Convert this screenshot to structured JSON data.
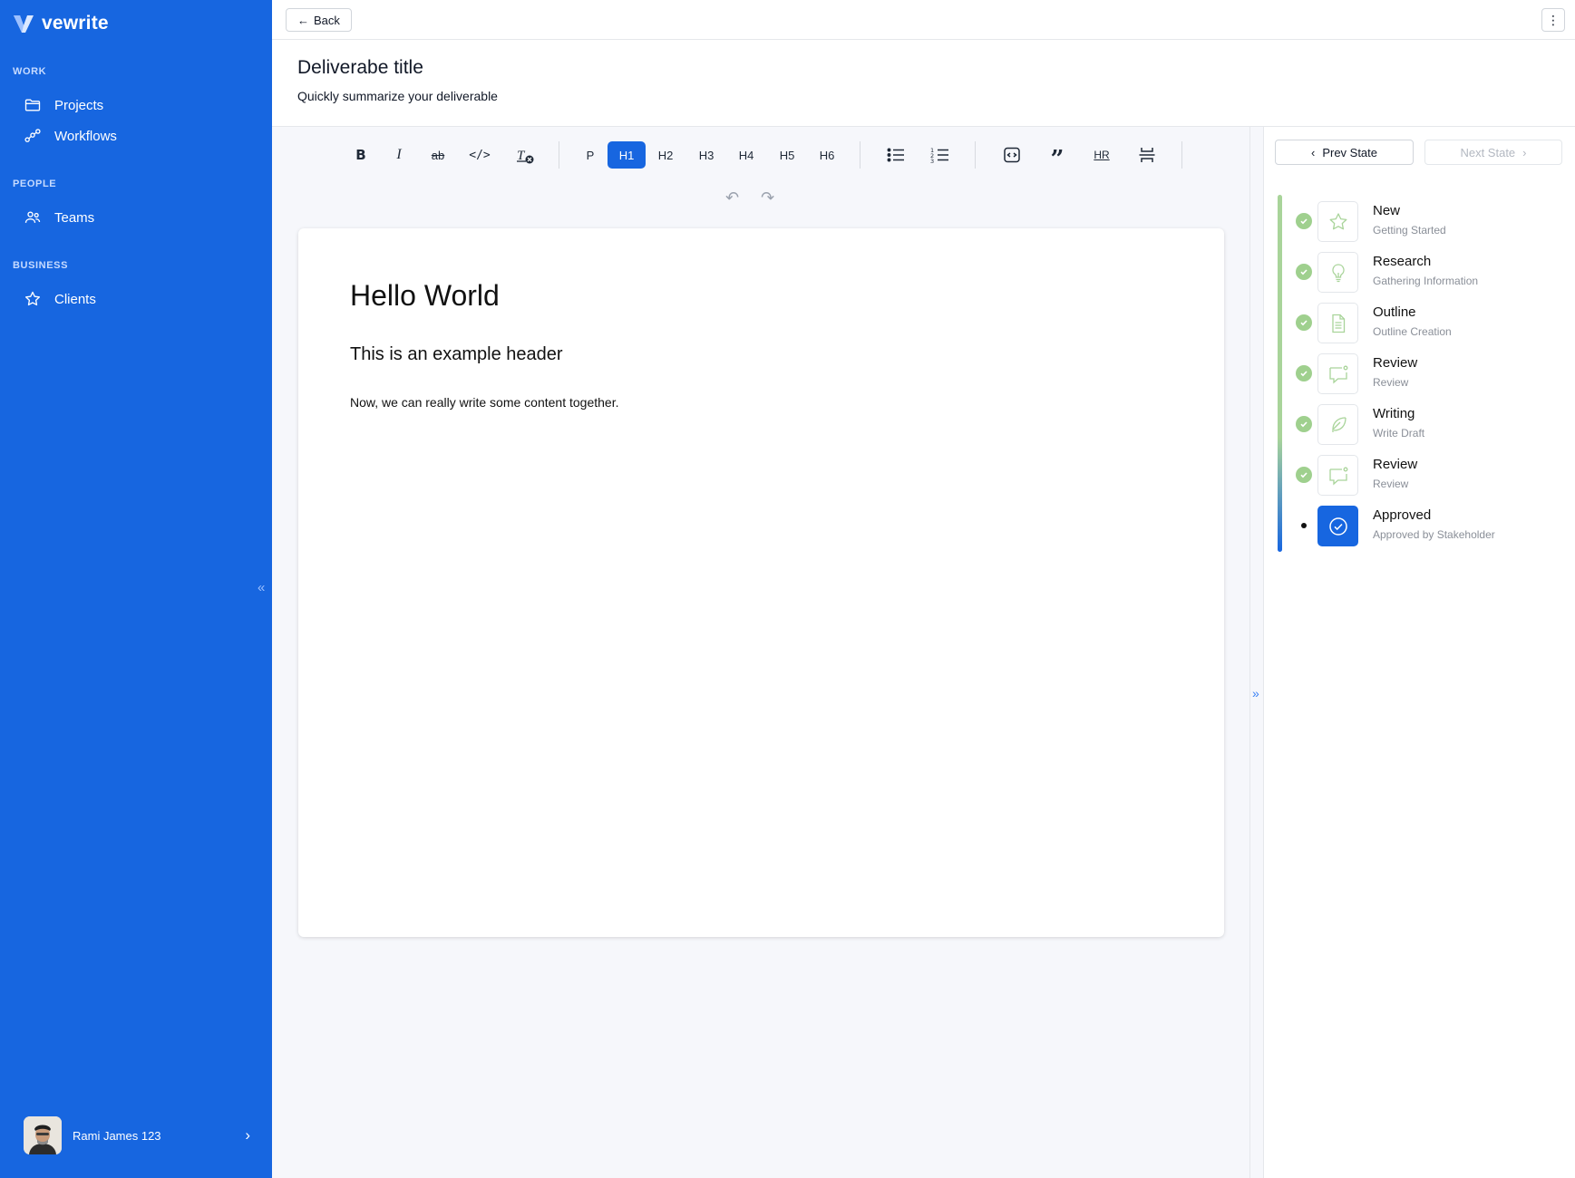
{
  "brand": {
    "name": "vewrite",
    "accent": "#1766e0"
  },
  "sidebar": {
    "sections": [
      {
        "label": "WORK",
        "items": [
          {
            "label": "Projects",
            "icon": "folder-icon"
          },
          {
            "label": "Workflows",
            "icon": "workflow-icon"
          }
        ]
      },
      {
        "label": "PEOPLE",
        "items": [
          {
            "label": "Teams",
            "icon": "users-icon"
          }
        ]
      },
      {
        "label": "BUSINESS",
        "items": [
          {
            "label": "Clients",
            "icon": "star-icon"
          }
        ]
      }
    ],
    "user": {
      "name": "Rami James 123"
    }
  },
  "topbar": {
    "back_label": "Back"
  },
  "document": {
    "title": "Deliverabe title",
    "subtitle": "Quickly summarize your deliverable",
    "content": {
      "h1": "Hello World",
      "h2": "This is an example header",
      "paragraph": "Now, we can really write some content together."
    }
  },
  "toolbar": {
    "headings": [
      "P",
      "H1",
      "H2",
      "H3",
      "H4",
      "H5",
      "H6"
    ],
    "active_heading": "H1",
    "hr_label": "HR"
  },
  "states": {
    "prev_label": "Prev State",
    "next_label": "Next State",
    "steps": [
      {
        "title": "New",
        "subtitle": "Getting Started",
        "icon": "star-icon",
        "done": true
      },
      {
        "title": "Research",
        "subtitle": "Gathering Information",
        "icon": "lightbulb-icon",
        "done": true
      },
      {
        "title": "Outline",
        "subtitle": "Outline Creation",
        "icon": "document-icon",
        "done": true
      },
      {
        "title": "Review",
        "subtitle": "Review",
        "icon": "comment-icon",
        "done": true
      },
      {
        "title": "Writing",
        "subtitle": "Write Draft",
        "icon": "feather-icon",
        "done": true
      },
      {
        "title": "Review",
        "subtitle": "Review",
        "icon": "comment-icon",
        "done": true
      },
      {
        "title": "Approved",
        "subtitle": "Approved by Stakeholder",
        "icon": "check-circle-icon",
        "done": false,
        "current": true
      }
    ]
  }
}
